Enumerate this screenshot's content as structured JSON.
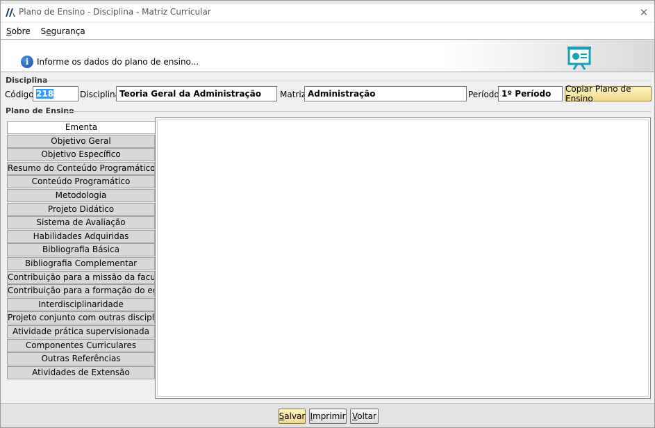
{
  "window": {
    "title": "Plano de Ensino - Disciplina - Matriz Curricular"
  },
  "menu": [
    {
      "label": "Sobre"
    },
    {
      "label": "Segurança"
    }
  ],
  "banner": {
    "message": "Informe os dados do plano de ensino..."
  },
  "disciplina_group": {
    "title": "Disciplina",
    "codigo_label": "Código:",
    "codigo_value": "218",
    "disciplina_label": "Disciplina:",
    "disciplina_value": "Teoria Geral da Administração",
    "matriz_label": "Matriz:",
    "matriz_value": "Administração",
    "periodo_label": "Período:",
    "periodo_value": "1º Período",
    "copy_button": "Copiar Plano de Ensino"
  },
  "plano_group": {
    "title": "Plano de Ensino",
    "active_tab": 0,
    "tabs": [
      "Ementa",
      "Objetivo Geral",
      "Objetivo Específico",
      "Resumo do Conteúdo Programático",
      "Conteúdo Programático",
      "Metodologia",
      "Projeto Didático",
      "Sistema de Avaliação",
      "Habilidades Adquiridas",
      "Bibliografia Básica",
      "Bibliografia Complementar",
      "Contribuição para a missão da faculdade",
      "Contribuição para a formação do egresso",
      "Interdisciplinaridade",
      "Projeto conjunto com outras disciplinas",
      "Atividade prática supervisionada",
      "Componentes Curriculares",
      "Outras Referências",
      "Atividades de Extensão"
    ],
    "editor_content": ""
  },
  "footer": {
    "save": "Salvar",
    "print": "Imprimir",
    "back": "Voltar"
  },
  "colors": {
    "selection": "#3399ff",
    "info_icon": "#1a4fa8",
    "board_icon": "#1a9fb8",
    "yellow_button": "#f0d98c"
  },
  "icons": {
    "app": "app-logo-icon",
    "info": "info-icon",
    "banner": "presentation-board-icon",
    "close": "close-icon"
  }
}
